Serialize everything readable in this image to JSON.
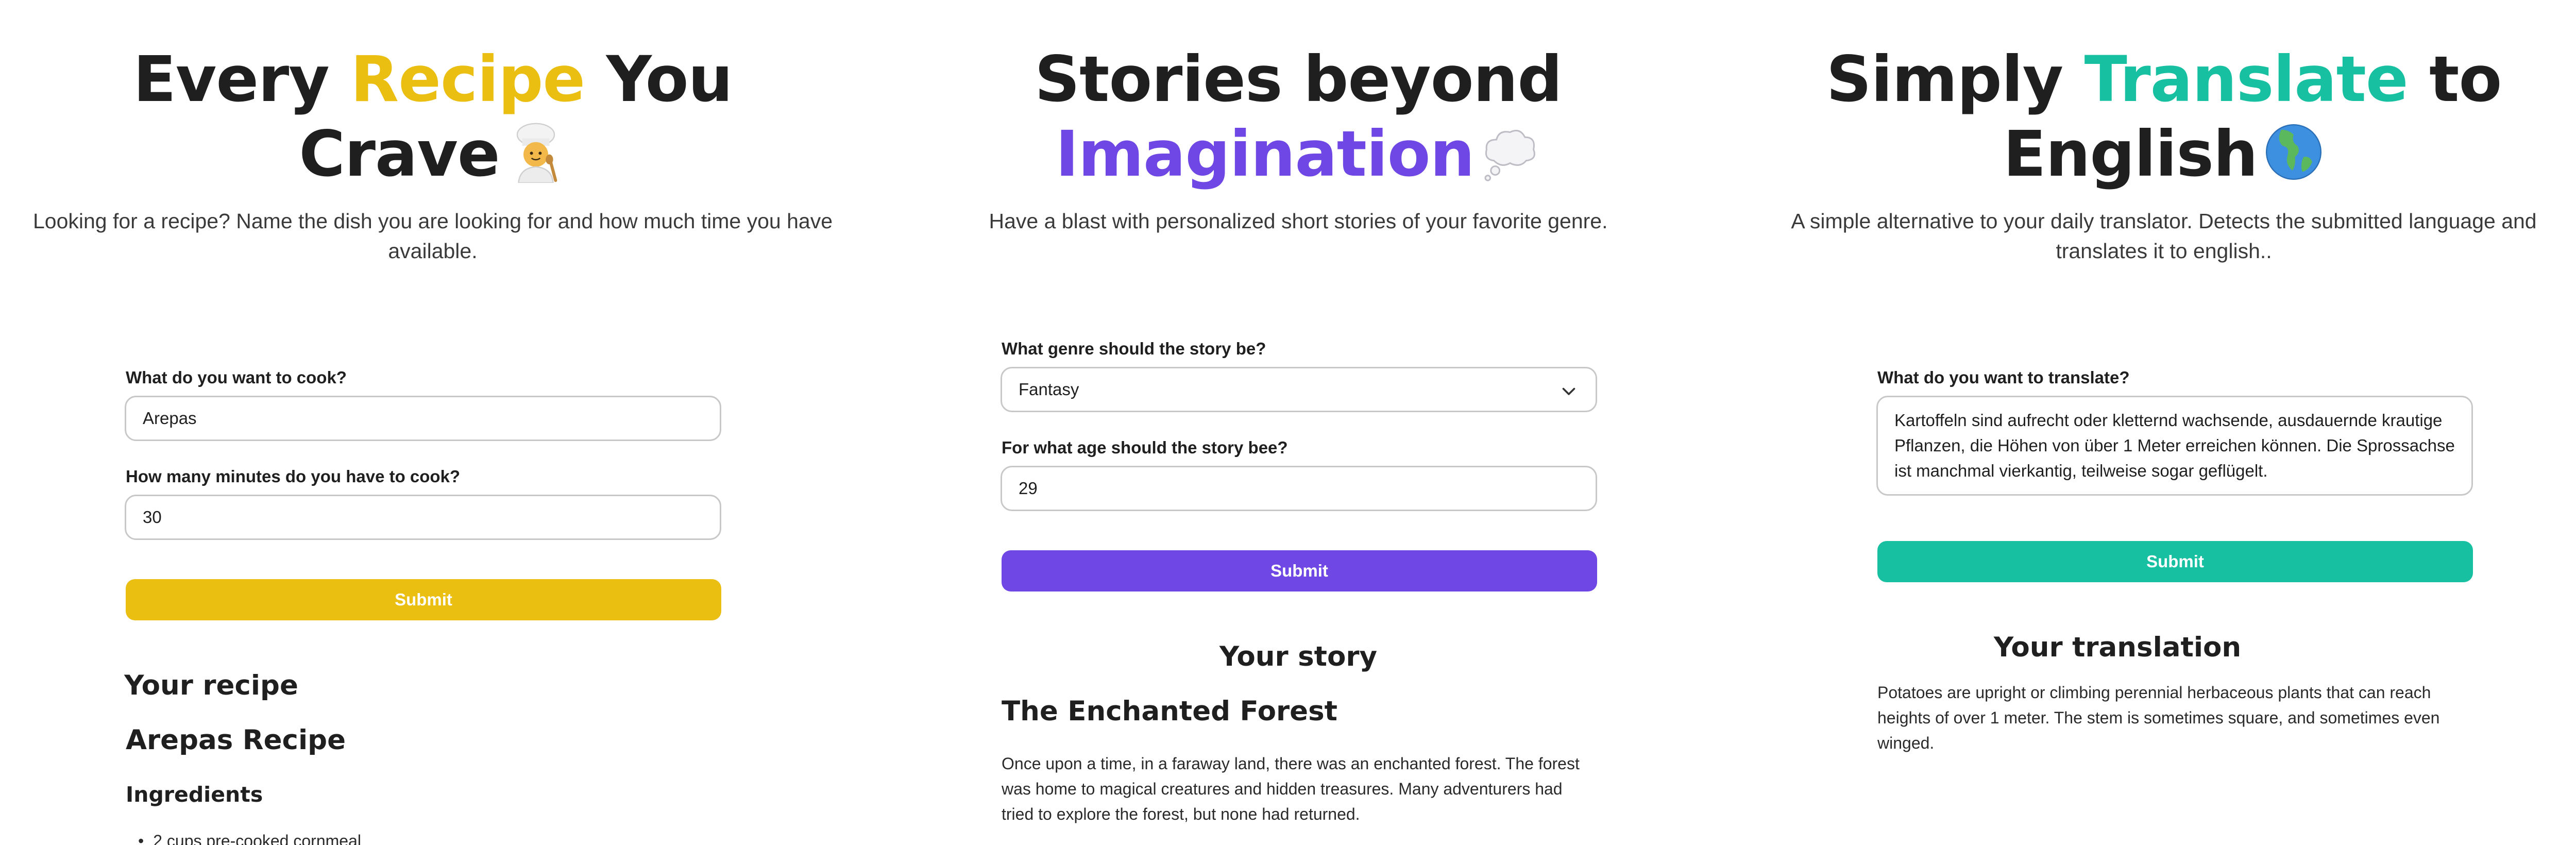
{
  "recipe": {
    "title_before": "Every ",
    "title_accent": "Recipe",
    "title_after": " You",
    "title_line2": "Crave",
    "emoji": "cook-icon",
    "subtitle": "Looking for a recipe? Name the dish you are looking for and how much time you have available.",
    "dish_label": "What do you want to cook?",
    "dish_value": "Arepas",
    "minutes_label": "How many minutes do you have to cook?",
    "minutes_value": "30",
    "submit_label": "Submit",
    "result_heading": "Your recipe",
    "recipe_title": "Arepas Recipe",
    "ingredients_heading": "Ingredients",
    "ingredients": [
      "2 cups pre-cooked cornmeal"
    ],
    "accent_color": "#ebbe12"
  },
  "story": {
    "title_line1": "Stories beyond",
    "title_accent": "Imagination",
    "emoji": "thought-bubble-icon",
    "subtitle": "Have a blast with personalized short stories of your favorite genre.",
    "genre_label": "What genre should the story be?",
    "genre_value": "Fantasy",
    "age_label": "For what age should the story bee?",
    "age_value": "29",
    "submit_label": "Submit",
    "result_heading": "Your story",
    "story_title": "The Enchanted Forest",
    "story_text": "Once upon a time, in a faraway land, there was an enchanted forest. The forest was home to magical creatures and hidden treasures. Many adventurers had tried to explore the forest, but none had returned.",
    "accent_color": "#6f47e4"
  },
  "translate": {
    "title_before": "Simply ",
    "title_accent": "Translate",
    "title_after": " to",
    "title_line2": "English",
    "emoji": "globe-icon",
    "subtitle": "A simple alternative to your daily translator. Detects the submitted language and translates it to english..",
    "input_label": "What do you want to translate?",
    "input_value": "Kartoffeln sind aufrecht oder kletternd wachsende, ausdauernde krautige Pflanzen, die Höhen von über 1 Meter erreichen können. Die Sprossachse ist manchmal vierkantig, teilweise sogar geflügelt.",
    "submit_label": "Submit",
    "result_heading": "Your translation",
    "result_text": "Potatoes are upright or climbing perennial herbaceous plants that can reach heights of over 1 meter. The stem is sometimes square, and sometimes even winged.",
    "accent_color": "#17c0a0"
  }
}
